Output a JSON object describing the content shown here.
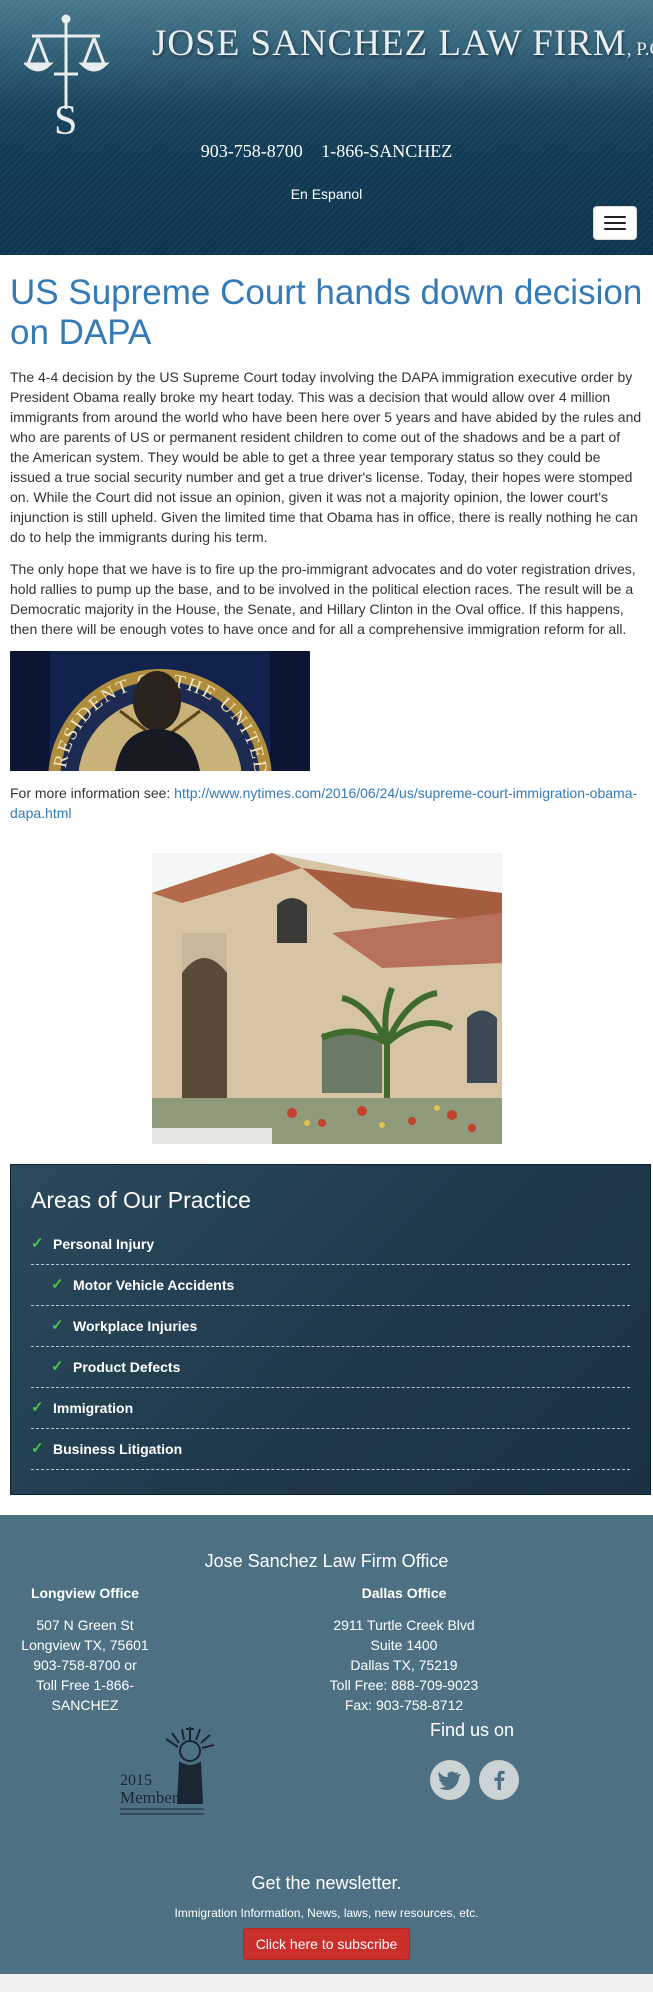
{
  "header": {
    "firm_name": "JOSE SANCHEZ LAW FIRM",
    "firm_suffix": "P.C.",
    "phone_1": "903-758-8700",
    "phone_2": "1-866-SANCHEZ",
    "language_link": "En Espanol",
    "menu_icon": "hamburger-menu-icon"
  },
  "article": {
    "title": "US Supreme Court hands down decision on DAPA",
    "paragraph_1": "The 4-4 decision by the US Supreme Court today involving the DAPA immigration executive order by President Obama really broke my heart today. This was a decision that would allow over 4 million immigrants from around the world who have been here over 5 years and have abided by the rules and who are parents of US or permanent resident children to come out of the shadows and be a part of the American system. They would be able to get a three year temporary status so they could be issued a true social security number and get a true driver's license. Today, their hopes were stomped on. While the Court did not issue an opinion, given it was not a majority opinion, the lower court's injunction is still upheld. Given the limited time that Obama has in office, there is really nothing he can do to help the immigrants during his term.",
    "paragraph_2": "The only hope that we have is to fire up the pro-immigrant advocates and do voter registration drives, hold rallies to pump up the base, and to be involved in the political election races. The result will be a Democratic majority in the House, the Senate, and Hillary Clinton in the Oval office. If this happens, then there will be enough votes to have once and for all a comprehensive immigration reform for all.",
    "seal_text": "PRESIDENT OF THE UNITED",
    "more_info_label": "For more information see: ",
    "more_info_link": "http://www.nytimes.com/2016/06/24/us/supreme-court-immigration-obama-dapa.html"
  },
  "practice": {
    "title": "Areas of Our Practice",
    "check_icon": "checkmark-icon",
    "items": [
      {
        "label": "Personal Injury",
        "level": 0
      },
      {
        "label": "Motor Vehicle Accidents",
        "level": 1
      },
      {
        "label": "Workplace Injuries",
        "level": 1
      },
      {
        "label": "Product Defects",
        "level": 1
      },
      {
        "label": "Immigration",
        "level": 0
      },
      {
        "label": "Business Litigation",
        "level": 0
      }
    ]
  },
  "footer": {
    "title": "Jose Sanchez Law Firm Office",
    "longview": {
      "heading": "Longview Office",
      "lines": [
        "507 N Green St",
        "Longview TX, 75601",
        "903-758-8700 or",
        "Toll Free 1-866-",
        "SANCHEZ"
      ]
    },
    "dallas": {
      "heading": "Dallas Office",
      "lines": [
        "2911 Turtle Creek Blvd",
        "Suite 1400",
        "Dallas TX, 75219",
        "Toll Free: 888-709-9023",
        "Fax: 903-758-8712"
      ]
    },
    "badge_year": "2015",
    "badge_word": "Member",
    "find_us": "Find us on",
    "social_icons": [
      "twitter-icon",
      "facebook-icon"
    ],
    "newsletter_title": "Get the newsletter.",
    "newsletter_text": "Immigration Information, News, laws, new resources, etc.",
    "subscribe_label": "Click here to subscribe"
  },
  "colors": {
    "header_dark": "#123c56",
    "link_blue": "#337ab7",
    "practice_bg": "#1e3749",
    "check_green": "#4cc34c",
    "footer_bg": "#4e7083",
    "subscribe_red": "#c9302c"
  }
}
